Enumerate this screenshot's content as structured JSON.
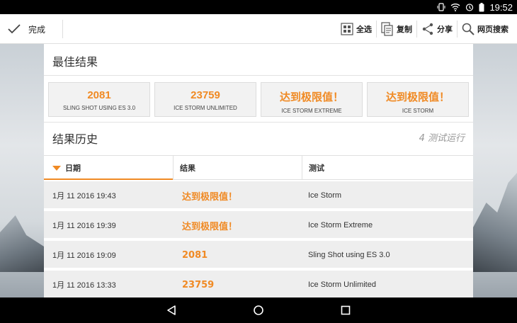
{
  "status": {
    "clock": "19:52"
  },
  "toolbar": {
    "done_label": "完成",
    "select_all_label": "全选",
    "copy_label": "复制",
    "share_label": "分享",
    "web_search_label": "网页搜索"
  },
  "best": {
    "title": "最佳结果",
    "cards": [
      {
        "value": "2081",
        "label": "SLING SHOT USING ES 3.0"
      },
      {
        "value": "23759",
        "label": "ICE STORM UNLIMITED"
      },
      {
        "value": "达到极限值！",
        "label": "ICE STORM EXTREME"
      },
      {
        "value": "达到极限值！",
        "label": "ICE STORM"
      }
    ]
  },
  "history": {
    "title": "结果历史",
    "runs_count": "4 测试运行",
    "columns": {
      "date": "日期",
      "result": "结果",
      "test": "测试"
    },
    "rows": [
      {
        "date": "1月 11 2016 19:43",
        "result": "达到极限值！",
        "test": "Ice Storm"
      },
      {
        "date": "1月 11 2016 19:39",
        "result": "达到极限值！",
        "test": "Ice Storm Extreme"
      },
      {
        "date": "1月 11 2016 19:09",
        "result": "2081",
        "test": "Sling Shot using ES 3.0"
      },
      {
        "date": "1月 11 2016 13:33",
        "result": "23759",
        "test": "Ice Storm Unlimited"
      }
    ]
  },
  "colors": {
    "accent": "#f08a24"
  },
  "icons": [
    "check-icon",
    "select-all-icon",
    "copy-icon",
    "share-icon",
    "search-icon",
    "back-icon",
    "home-icon",
    "recents-icon",
    "vibrate-icon",
    "wifi-icon",
    "alarm-icon",
    "battery-icon"
  ]
}
